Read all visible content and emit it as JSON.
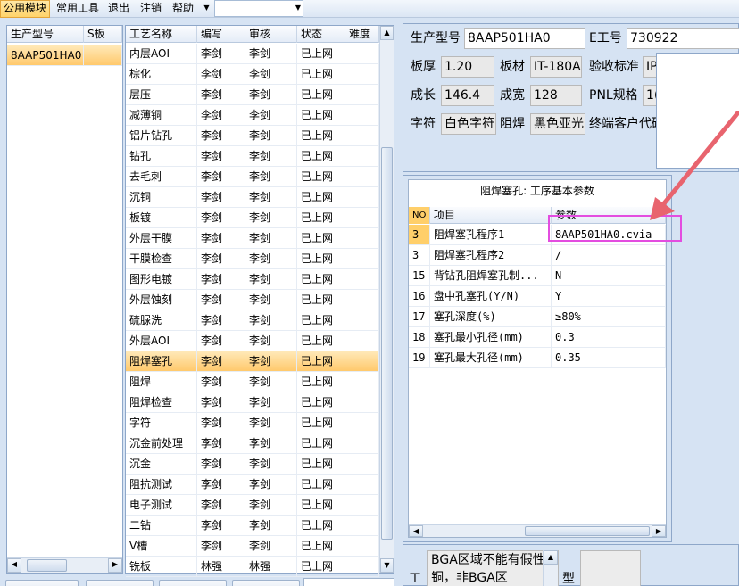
{
  "menu": {
    "items": [
      "公用模块",
      "常用工具",
      "退出",
      "注销",
      "帮助"
    ],
    "combo_value": ""
  },
  "left_grid": {
    "columns": [
      "生产型号",
      "S板"
    ],
    "rows": [
      [
        "8AAP501HA0",
        ""
      ]
    ]
  },
  "process_grid": {
    "columns": [
      "工艺名称",
      "编写",
      "审核",
      "状态",
      "难度"
    ],
    "rows": [
      [
        "内层AOI",
        "李剑",
        "李剑",
        "已上网",
        ""
      ],
      [
        "棕化",
        "李剑",
        "李剑",
        "已上网",
        ""
      ],
      [
        "层压",
        "李剑",
        "李剑",
        "已上网",
        ""
      ],
      [
        "减薄铜",
        "李剑",
        "李剑",
        "已上网",
        ""
      ],
      [
        "铝片钻孔",
        "李剑",
        "李剑",
        "已上网",
        ""
      ],
      [
        "钻孔",
        "李剑",
        "李剑",
        "已上网",
        ""
      ],
      [
        "去毛刺",
        "李剑",
        "李剑",
        "已上网",
        ""
      ],
      [
        "沉铜",
        "李剑",
        "李剑",
        "已上网",
        ""
      ],
      [
        "板镀",
        "李剑",
        "李剑",
        "已上网",
        ""
      ],
      [
        "外层干膜",
        "李剑",
        "李剑",
        "已上网",
        ""
      ],
      [
        "干膜检查",
        "李剑",
        "李剑",
        "已上网",
        ""
      ],
      [
        "图形电镀",
        "李剑",
        "李剑",
        "已上网",
        ""
      ],
      [
        "外层蚀刻",
        "李剑",
        "李剑",
        "已上网",
        ""
      ],
      [
        "硫脲洗",
        "李剑",
        "李剑",
        "已上网",
        ""
      ],
      [
        "外层AOI",
        "李剑",
        "李剑",
        "已上网",
        ""
      ],
      [
        "阻焊塞孔",
        "李剑",
        "李剑",
        "已上网",
        ""
      ],
      [
        "阻焊",
        "李剑",
        "李剑",
        "已上网",
        ""
      ],
      [
        "阻焊检查",
        "李剑",
        "李剑",
        "已上网",
        ""
      ],
      [
        "字符",
        "李剑",
        "李剑",
        "已上网",
        ""
      ],
      [
        "沉金前处理",
        "李剑",
        "李剑",
        "已上网",
        ""
      ],
      [
        "沉金",
        "李剑",
        "李剑",
        "已上网",
        ""
      ],
      [
        "阻抗测试",
        "李剑",
        "李剑",
        "已上网",
        ""
      ],
      [
        "电子测试",
        "李剑",
        "李剑",
        "已上网",
        ""
      ],
      [
        "二钻",
        "李剑",
        "李剑",
        "已上网",
        ""
      ],
      [
        "V槽",
        "李剑",
        "李剑",
        "已上网",
        ""
      ],
      [
        "铣板",
        "林强",
        "林强",
        "已上网",
        ""
      ]
    ],
    "selected_index": 15
  },
  "info": {
    "model_label": "生产型号",
    "model_value": "8AAP501HA0",
    "eng_label": "E工号",
    "eng_value": "730922",
    "thickness_label": "板厚",
    "thickness_value": "1.20",
    "material_label": "板材",
    "material_value": "IT-180A",
    "standard_label": "验收标准",
    "standard_value": "IP",
    "length_label": "成长",
    "length_value": "146.4",
    "width_label": "成宽",
    "width_value": "128",
    "pnl_label": "PNL规格",
    "pnl_value": "1(",
    "char_label": "字符",
    "char_value": "白色字符",
    "mask_label": "阻焊",
    "mask_value": "黑色亚光",
    "customer_label": "终端客户代码"
  },
  "params": {
    "title": "阻焊塞孔: 工序基本参数",
    "columns": [
      "NO",
      "项目",
      "参数"
    ],
    "rows": [
      [
        "3",
        "阻焊塞孔程序1",
        "8AAP501HA0.cvia"
      ],
      [
        "3",
        "阻焊塞孔程序2",
        "/"
      ],
      [
        "15",
        "背钻孔阻焊塞孔制...",
        "N"
      ],
      [
        "16",
        "盘中孔塞孔(Y/N)",
        "Y"
      ],
      [
        "17",
        "塞孔深度(%)",
        "≥80%"
      ],
      [
        "18",
        "塞孔最小孔径(mm)",
        "0.3"
      ],
      [
        "19",
        "塞孔最大孔径(mm)",
        "0.35"
      ]
    ]
  },
  "bottom": {
    "left_label": "工",
    "note": "BGA区域不能有假性露铜，非BGA区",
    "right_label": "型"
  },
  "colors": {
    "accent": "#ffc96c",
    "highlight": "#e34de0",
    "arrow": "#e8646e"
  }
}
